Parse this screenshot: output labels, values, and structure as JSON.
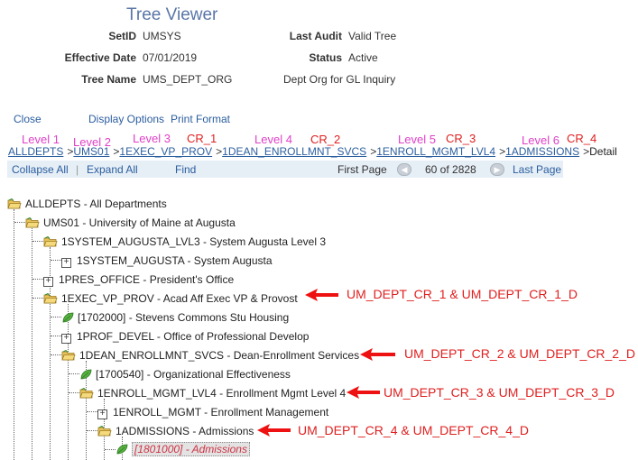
{
  "header": {
    "title": "Tree Viewer",
    "setid_label": "SetID",
    "setid_value": "UMSYS",
    "last_audit_label": "Last Audit",
    "last_audit_value": "Valid Tree",
    "effdate_label": "Effective Date",
    "effdate_value": "07/01/2019",
    "status_label": "Status",
    "status_value": "Active",
    "treename_label": "Tree Name",
    "treename_value": "UMS_DEPT_ORG",
    "tree_desc": "Dept Org for GL Inquiry"
  },
  "actions": {
    "close": "Close",
    "display_options": "Display Options",
    "print_format": "Print Format"
  },
  "levels": {
    "l1": "Level 1",
    "l2": "Level 2",
    "l3": "Level 3",
    "cr1": "CR_1",
    "l4": "Level 4",
    "cr2": "CR_2",
    "l5": "Level 5",
    "cr3": "CR_3",
    "l6": "Level 6",
    "cr4": "CR_4"
  },
  "breadcrumb": {
    "items": [
      "ALLDEPTS",
      "UMS01",
      "1EXEC_VP_PROV",
      "1DEAN_ENROLLMNT_SVCS",
      "1ENROLL_MGMT_LVL4",
      "1ADMISSIONS"
    ],
    "sep": ">",
    "last": "Detail"
  },
  "toolbar": {
    "collapse_all": "Collapse All",
    "divider": "|",
    "expand_all": "Expand All",
    "find": "Find",
    "first_page": "First Page",
    "count": "60 of 2828",
    "last_page": "Last Page"
  },
  "tree": [
    "ALLDEPTS - All Departments",
    "UMS01 - University of Maine at Augusta",
    "1SYSTEM_AUGUSTA_LVL3 - System Augusta Level 3",
    "1SYSTEM_AUGUSTA - System Augusta",
    "1PRES_OFFICE - President's Office",
    "1EXEC_VP_PROV - Acad Aff Exec VP & Provost",
    "[1702000] - Stevens Commons Stu Housing",
    "1PROF_DEVEL - Office of Professional Develop",
    "1DEAN_ENROLLMNT_SVCS - Dean-Enrollment Services",
    "[1700540] - Organizational Effectiveness",
    "1ENROLL_MGMT_LVL4 - Enrollment Mgmt Level 4",
    "1ENROLL_MGMT - Enrollment Management",
    "1ADMISSIONS - Admissions",
    "[1801000] - Admissions"
  ],
  "annotations": {
    "a1": "UM_DEPT_CR_1 & UM_DEPT_CR_1_D",
    "a2": "UM_DEPT_CR_2 & UM_DEPT_CR_2_D",
    "a3": "UM_DEPT_CR_3 & UM_DEPT_CR_3_D",
    "a4": "UM_DEPT_CR_4 & UM_DEPT_CR_4_D"
  },
  "colors": {
    "level": "#e040c8",
    "cr": "#e02020",
    "link": "#2b5e9e",
    "title": "#5a76a8"
  }
}
